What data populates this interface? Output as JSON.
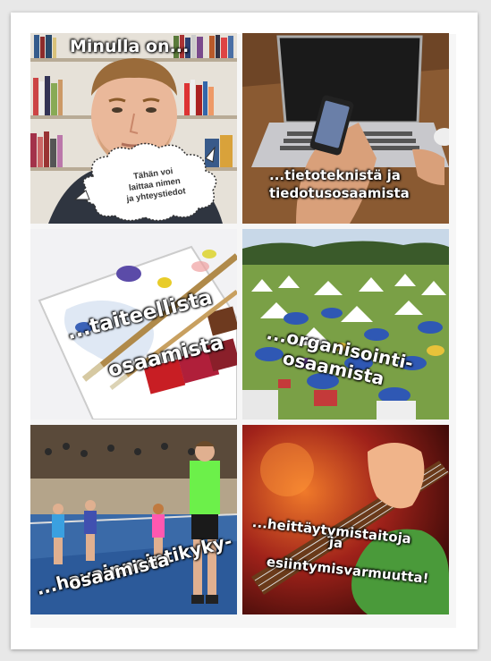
{
  "tiles": {
    "t1": {
      "title": "Minulla on...",
      "bubble_line1": "Tähän voi",
      "bubble_line2": "laittaa nimen",
      "bubble_line3": "ja yhteystiedot"
    },
    "t2": {
      "line1": "...tietoteknistä ja",
      "line2": "tiedotusosaamista"
    },
    "t3": {
      "line1": "...taiteellista",
      "line2": "osaamista"
    },
    "t4": {
      "line1": "...organisointi-",
      "line2": "osaamista"
    },
    "t5": {
      "line1": "...havainnointikyky-",
      "line2": "osaamista"
    },
    "t6": {
      "line1": "...heittäytymistaitoja",
      "line2": "ja",
      "line3": "esiintymisvarmuutta!"
    }
  }
}
